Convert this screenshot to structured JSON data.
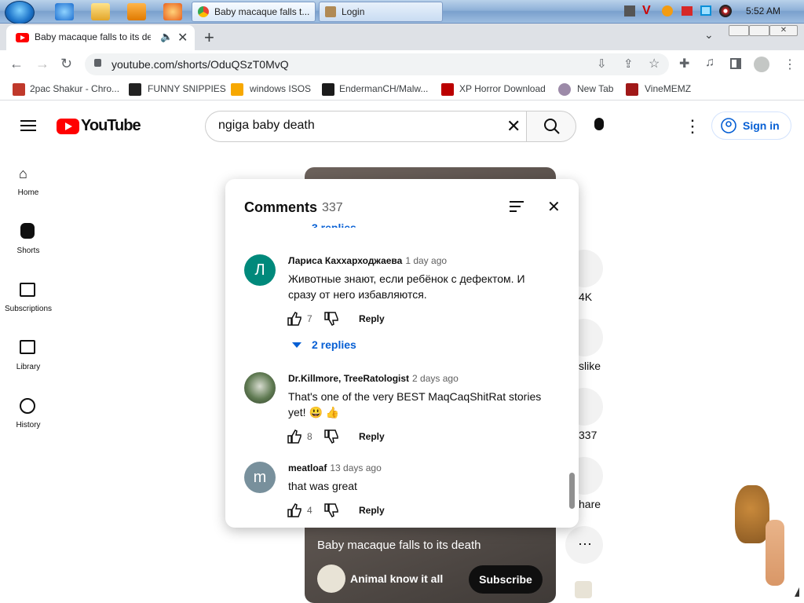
{
  "taskbar": {
    "tasks": [
      "Baby macaque falls t...",
      "Login"
    ],
    "clock": "5:52 AM"
  },
  "browser": {
    "tab_title": "Baby macaque falls to its de",
    "url": "youtube.com/shorts/OduQSzT0MvQ",
    "bookmarks": [
      "2pac Shakur - Chro...",
      "FUNNY SNIPPIES",
      "windows ISOS",
      "EndermanCH/Malw...",
      "XP Horror Download",
      "New Tab",
      "VineMEMZ"
    ]
  },
  "youtube": {
    "logo_text": "YouTube",
    "search_value": "ngiga baby death",
    "signin_label": "Sign in",
    "guide": [
      "Home",
      "Shorts",
      "Subscriptions",
      "Library",
      "History"
    ],
    "actions": {
      "likes": "4K",
      "dislike": "slike",
      "comments": "337",
      "share": "hare"
    },
    "video_title": "Baby macaque falls to its death",
    "channel": "Animal know it all",
    "subscribe_label": "Subscribe"
  },
  "comments": {
    "title": "Comments",
    "count": "337",
    "partial_replies": "3 replies",
    "items": [
      {
        "avatar": "Л",
        "author": "Лариса Каххарходжаева",
        "time": "1 day ago",
        "text": "Животные знают, если ребёнок с дефектом. И сразу от него избавляются.",
        "likes": "7",
        "reply": "Reply",
        "replies": "2 replies"
      },
      {
        "avatar": "",
        "author": "Dr.Killmore, TreeRatologist",
        "time": "2 days ago",
        "text": "That's one of the very BEST MaqCaqShitRat stories yet!  😃 👍",
        "likes": "8",
        "reply": "Reply"
      },
      {
        "avatar": "m",
        "author": "meatloaf",
        "time": "13 days ago",
        "text": "that was great",
        "likes": "4",
        "reply": "Reply"
      }
    ]
  },
  "colors": {
    "yt_red": "#ff0000",
    "link_blue": "#065fd4",
    "avatar_teal": "#00897b",
    "avatar_gray": "#78909c"
  }
}
